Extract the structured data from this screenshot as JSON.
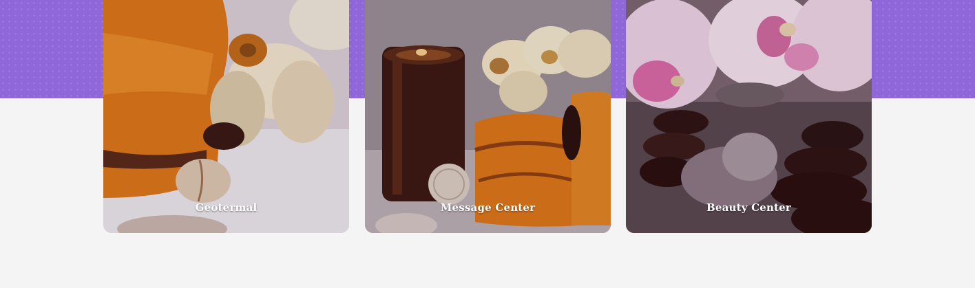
{
  "colors": {
    "band": "#8f67d9",
    "page_bg": "#f4f4f4",
    "label_text": "#ffffff"
  },
  "services": [
    {
      "title": "Geotermal",
      "image_subject": "orange towels, white orchid and stones"
    },
    {
      "title": "Message Center",
      "image_subject": "wooden candle, cream orchids and rolled orange towels"
    },
    {
      "title": "Beauty Center",
      "image_subject": "pink orchids over dark spa stones"
    }
  ]
}
